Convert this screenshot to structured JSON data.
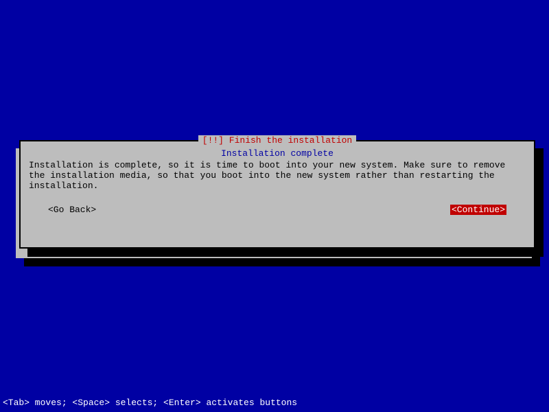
{
  "dialog": {
    "title": "[!!] Finish the installation",
    "subtitle": "Installation complete",
    "body": "Installation is complete, so it is time to boot into your new system. Make sure to remove the installation media, so that you boot into the new system rather than restarting the installation.",
    "go_back_label": "<Go Back>",
    "continue_label": "<Continue>"
  },
  "footer": {
    "text": "<Tab> moves; <Space> selects; <Enter> activates buttons"
  }
}
